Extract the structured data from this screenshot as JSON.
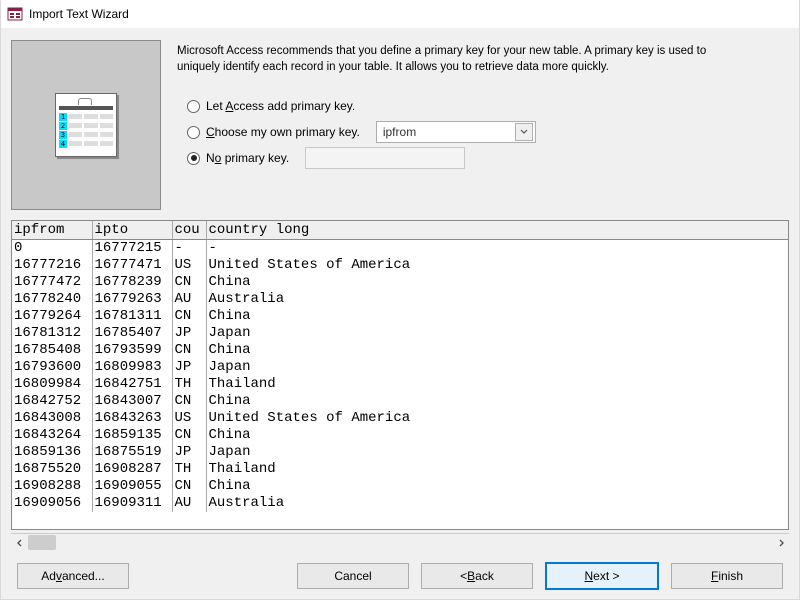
{
  "window": {
    "title": "Import Text Wizard"
  },
  "instructions": "Microsoft Access recommends that you define a primary key for your new table. A primary key is used to uniquely identify each record in your table. It allows you to retrieve data more quickly.",
  "options": {
    "let_access": {
      "pre": "Let ",
      "accel": "A",
      "post": "ccess add primary key.",
      "selected": false
    },
    "choose_own": {
      "accel": "C",
      "post": "hoose my own primary key.",
      "selected": false,
      "field": "ipfrom"
    },
    "no_pk": {
      "pre": "N",
      "accel": "o",
      "post": " primary key.",
      "selected": true
    }
  },
  "columns": [
    "ipfrom",
    "ipto",
    "cou",
    "country long"
  ],
  "col_widths": [
    "80px",
    "80px",
    "34px",
    "auto"
  ],
  "rows": [
    [
      "0",
      "16777215",
      "-",
      "-"
    ],
    [
      "16777216",
      "16777471",
      "US",
      "United States of America"
    ],
    [
      "16777472",
      "16778239",
      "CN",
      "China"
    ],
    [
      "16778240",
      "16779263",
      "AU",
      "Australia"
    ],
    [
      "16779264",
      "16781311",
      "CN",
      "China"
    ],
    [
      "16781312",
      "16785407",
      "JP",
      "Japan"
    ],
    [
      "16785408",
      "16793599",
      "CN",
      "China"
    ],
    [
      "16793600",
      "16809983",
      "JP",
      "Japan"
    ],
    [
      "16809984",
      "16842751",
      "TH",
      "Thailand"
    ],
    [
      "16842752",
      "16843007",
      "CN",
      "China"
    ],
    [
      "16843008",
      "16843263",
      "US",
      "United States of America"
    ],
    [
      "16843264",
      "16859135",
      "CN",
      "China"
    ],
    [
      "16859136",
      "16875519",
      "JP",
      "Japan"
    ],
    [
      "16875520",
      "16908287",
      "TH",
      "Thailand"
    ],
    [
      "16908288",
      "16909055",
      "CN",
      "China"
    ],
    [
      "16909056",
      "16909311",
      "AU",
      "Australia"
    ]
  ],
  "buttons": {
    "advanced": {
      "label_pre": "Ad",
      "accel": "v",
      "label_post": "anced..."
    },
    "cancel": "Cancel",
    "back": {
      "pre": "< ",
      "accel": "B",
      "post": "ack"
    },
    "next": {
      "accel": "N",
      "post": "ext >"
    },
    "finish": {
      "accel": "F",
      "post": "inish"
    }
  },
  "thumb_indices": [
    "1",
    "2",
    "3",
    "4"
  ]
}
